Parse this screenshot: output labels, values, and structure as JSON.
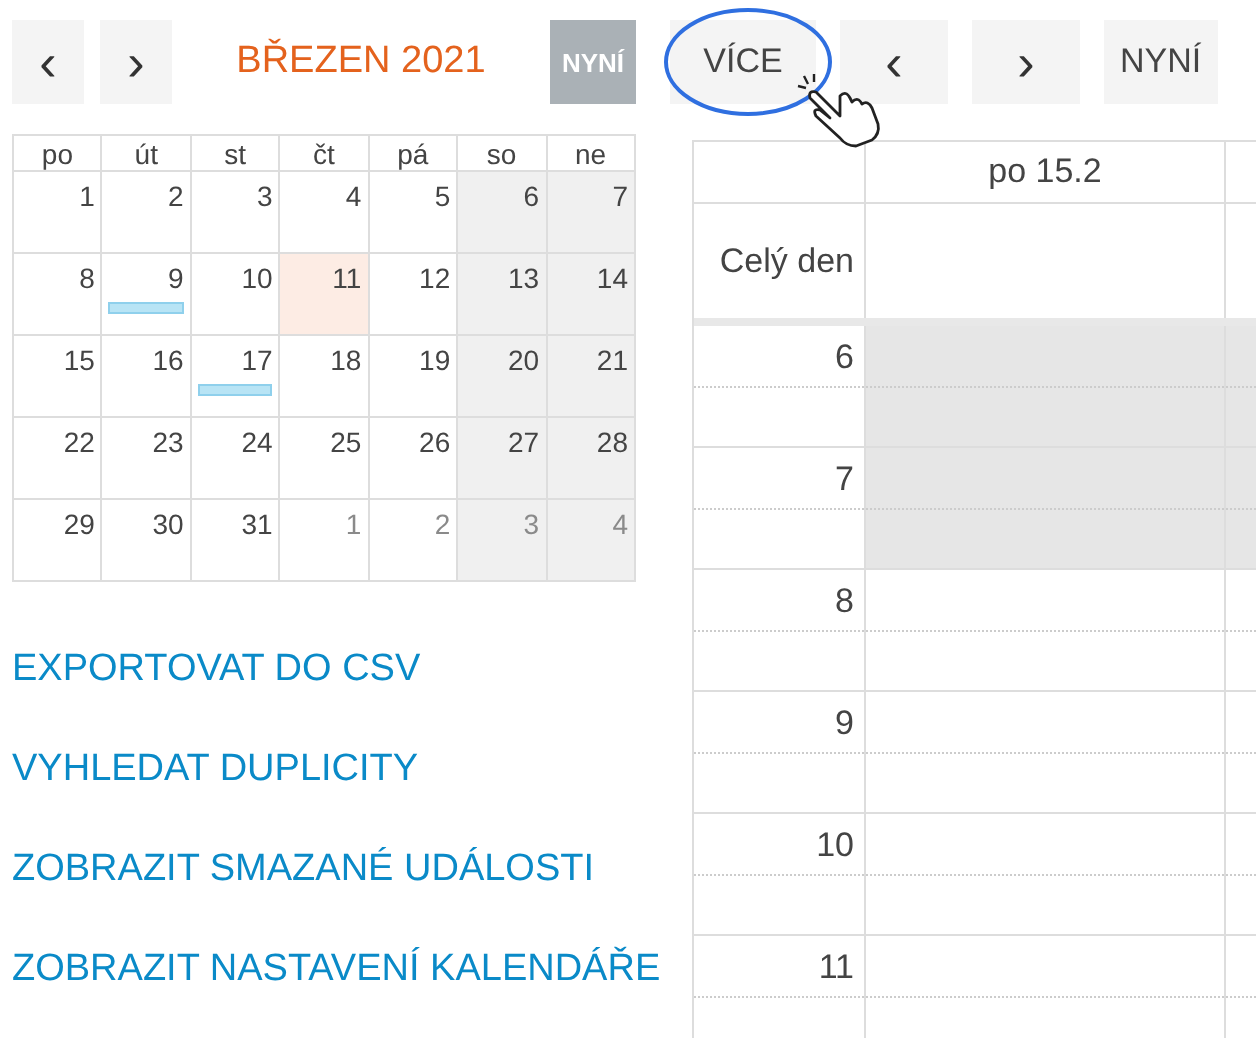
{
  "mini_nav": {
    "prev": "‹",
    "next": "›",
    "title": "BŘEZEN 2021",
    "today": {
      "label": "NYNÍ",
      "disabled": true
    }
  },
  "week_nav": {
    "more": {
      "label": "VÍCE",
      "highlighted": true
    },
    "prev": "‹",
    "next": "›",
    "today": {
      "label": "NYNÍ",
      "disabled": false
    }
  },
  "mini_calendar": {
    "weekdays": [
      {
        "label": "po",
        "weekend": false
      },
      {
        "label": "út",
        "weekend": false
      },
      {
        "label": "st",
        "weekend": false
      },
      {
        "label": "čt",
        "weekend": false
      },
      {
        "label": "pá",
        "weekend": false
      },
      {
        "label": "so",
        "weekend": true
      },
      {
        "label": "ne",
        "weekend": true
      }
    ],
    "weeks": [
      [
        {
          "label": "1",
          "other_month": false,
          "today": false,
          "event": false
        },
        {
          "label": "2",
          "other_month": false,
          "today": false,
          "event": false
        },
        {
          "label": "3",
          "other_month": false,
          "today": false,
          "event": false
        },
        {
          "label": "4",
          "other_month": false,
          "today": false,
          "event": false
        },
        {
          "label": "5",
          "other_month": false,
          "today": false,
          "event": false
        },
        {
          "label": "6",
          "other_month": false,
          "today": false,
          "event": false
        },
        {
          "label": "7",
          "other_month": false,
          "today": false,
          "event": false
        }
      ],
      [
        {
          "label": "8",
          "other_month": false,
          "today": false,
          "event": false
        },
        {
          "label": "9",
          "other_month": false,
          "today": false,
          "event": true
        },
        {
          "label": "10",
          "other_month": false,
          "today": false,
          "event": false
        },
        {
          "label": "11",
          "other_month": false,
          "today": true,
          "event": false
        },
        {
          "label": "12",
          "other_month": false,
          "today": false,
          "event": false
        },
        {
          "label": "13",
          "other_month": false,
          "today": false,
          "event": false
        },
        {
          "label": "14",
          "other_month": false,
          "today": false,
          "event": false
        }
      ],
      [
        {
          "label": "15",
          "other_month": false,
          "today": false,
          "event": false
        },
        {
          "label": "16",
          "other_month": false,
          "today": false,
          "event": false
        },
        {
          "label": "17",
          "other_month": false,
          "today": false,
          "event": true
        },
        {
          "label": "18",
          "other_month": false,
          "today": false,
          "event": false
        },
        {
          "label": "19",
          "other_month": false,
          "today": false,
          "event": false
        },
        {
          "label": "20",
          "other_month": false,
          "today": false,
          "event": false
        },
        {
          "label": "21",
          "other_month": false,
          "today": false,
          "event": false
        }
      ],
      [
        {
          "label": "22",
          "other_month": false,
          "today": false,
          "event": false
        },
        {
          "label": "23",
          "other_month": false,
          "today": false,
          "event": false
        },
        {
          "label": "24",
          "other_month": false,
          "today": false,
          "event": false
        },
        {
          "label": "25",
          "other_month": false,
          "today": false,
          "event": false
        },
        {
          "label": "26",
          "other_month": false,
          "today": false,
          "event": false
        },
        {
          "label": "27",
          "other_month": false,
          "today": false,
          "event": false
        },
        {
          "label": "28",
          "other_month": false,
          "today": false,
          "event": false
        }
      ],
      [
        {
          "label": "29",
          "other_month": false,
          "today": false,
          "event": false
        },
        {
          "label": "30",
          "other_month": false,
          "today": false,
          "event": false
        },
        {
          "label": "31",
          "other_month": false,
          "today": false,
          "event": false
        },
        {
          "label": "1",
          "other_month": true,
          "today": false,
          "event": false
        },
        {
          "label": "2",
          "other_month": true,
          "today": false,
          "event": false
        },
        {
          "label": "3",
          "other_month": true,
          "today": false,
          "event": false
        },
        {
          "label": "4",
          "other_month": true,
          "today": false,
          "event": false
        }
      ]
    ]
  },
  "links": [
    "EXPORTOVAT DO CSV",
    "VYHLEDAT DUPLICITY",
    "ZOBRAZIT SMAZANÉ UDÁLOSTI",
    "ZOBRAZIT NASTAVENÍ KALENDÁŘE"
  ],
  "week_view": {
    "day_headers": [
      "po 15.2"
    ],
    "all_day_label": "Celý den",
    "hours": [
      {
        "label": "6",
        "off_hours": true
      },
      {
        "label": "7",
        "off_hours": true
      },
      {
        "label": "8",
        "off_hours": false
      },
      {
        "label": "9",
        "off_hours": false
      },
      {
        "label": "10",
        "off_hours": false
      },
      {
        "label": "11",
        "off_hours": false
      }
    ]
  }
}
